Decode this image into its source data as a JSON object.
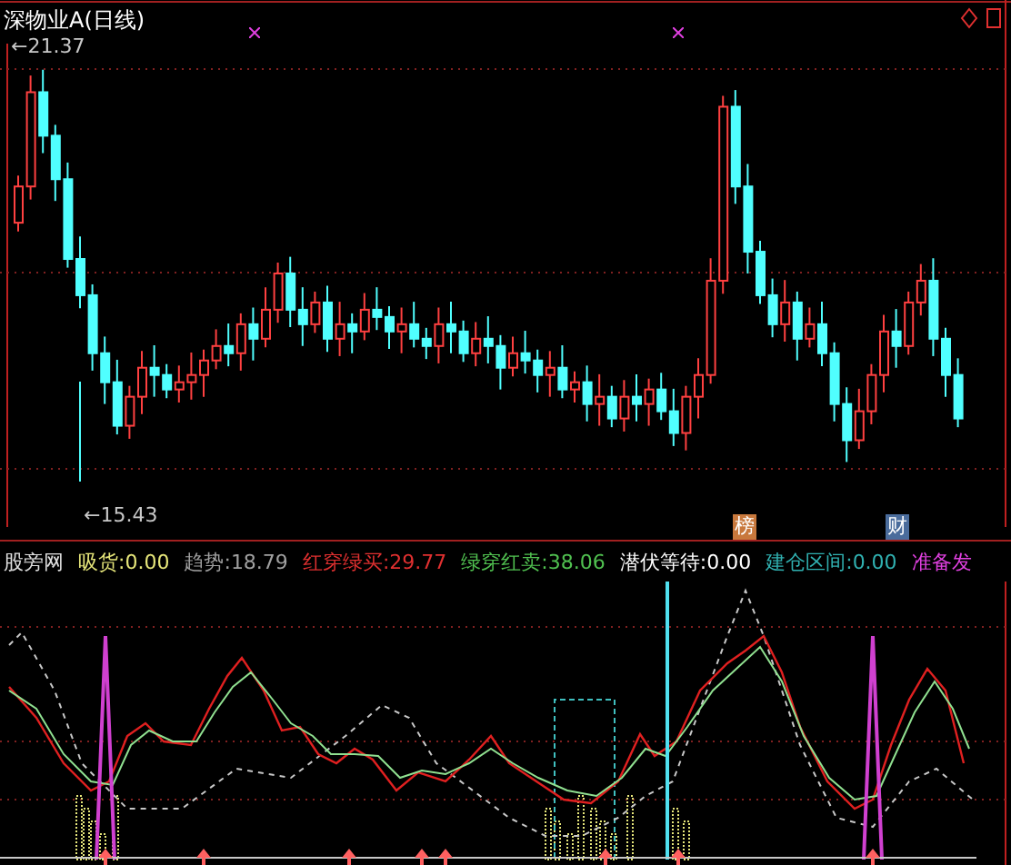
{
  "title": "深物业A(日线)",
  "price_high": "←21.37",
  "price_low": "←15.43",
  "markers": [
    {
      "text": "榜",
      "color": "#c8783c"
    },
    {
      "text": "财",
      "color": "#4a6c9c"
    }
  ],
  "indicator": {
    "name": "股旁网",
    "values": [
      {
        "label": "吸货:",
        "value": "0.00",
        "color": "#e6e67a"
      },
      {
        "label": "趋势:",
        "value": "18.79",
        "color": "#a0a0a0"
      },
      {
        "label": "红穿绿买:",
        "value": "29.77",
        "color": "#e03030"
      },
      {
        "label": "绿穿红卖:",
        "value": "38.06",
        "color": "#50c050"
      },
      {
        "label": "潜伏等待:",
        "value": "0.00",
        "color": "#ffffff"
      },
      {
        "label": "建仓区间:",
        "value": "0.00",
        "color": "#30b0b0"
      },
      {
        "label": "准备发",
        "color": "#e040e0"
      }
    ]
  }
}
